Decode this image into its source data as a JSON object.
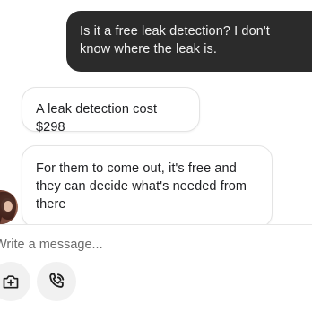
{
  "messages": [
    {
      "direction": "outgoing",
      "text": "Is it a free leak detection? I don't know where the leak is."
    },
    {
      "direction": "incoming",
      "text": "A leak detection cost $298"
    },
    {
      "direction": "incoming",
      "text": "For them to come out, it's free and they can decide what's needed from there"
    }
  ],
  "composer": {
    "placeholder": "Write a message...",
    "value": ""
  },
  "icons": {
    "attach": "add-photo-camera-icon",
    "call": "phone-call-icon"
  },
  "colors": {
    "outgoing_bubble": "#2b2b2b",
    "incoming_bubble": "#ffffff",
    "tool_button": "#f1f1f1"
  }
}
